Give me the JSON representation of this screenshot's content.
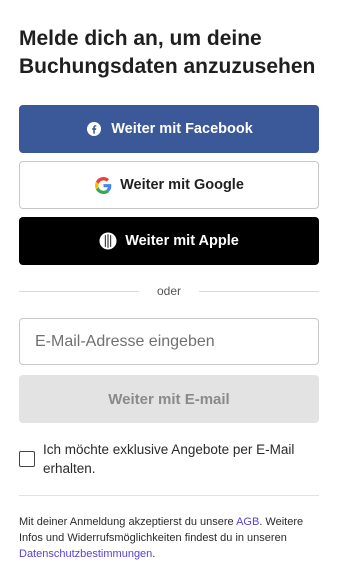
{
  "title": "Melde dich an, um deine Buchungsdaten anzuzusehen",
  "buttons": {
    "facebook": "Weiter mit Facebook",
    "google": "Weiter mit Google",
    "apple": "Weiter mit Apple",
    "email": "Weiter mit E-mail"
  },
  "divider_text": "oder",
  "email_input": {
    "placeholder": "E-Mail-Adresse eingeben",
    "value": ""
  },
  "newsletter_checkbox": {
    "label": "Ich möchte exklusive Angebote per E-Mail erhalten.",
    "checked": false
  },
  "legal": {
    "part1": "Mit deiner Anmeldung akzeptierst du unsere ",
    "agb_link": "AGB",
    "part2": ". Weitere Infos und Widerrufsmöglichkeiten findest du in unseren ",
    "privacy_link": "Datenschutzbestimmungen",
    "part3": "."
  },
  "icons": {
    "facebook": "facebook-icon",
    "google": "google-icon",
    "apple": "apple-icon"
  },
  "colors": {
    "facebook_blue": "#3b5998",
    "apple_black": "#000000",
    "link_purple": "#5a3fd8",
    "email_button_bg": "#e3e3e3"
  }
}
